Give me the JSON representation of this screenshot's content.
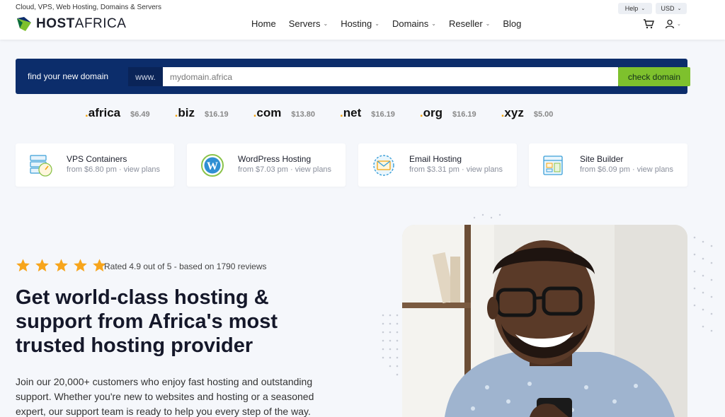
{
  "header": {
    "tagline": "Cloud, VPS, Web Hosting, Domains & Servers",
    "logo": {
      "bold": "HOST",
      "rest": "AFRICA"
    },
    "nav": [
      {
        "label": "Home",
        "dropdown": false
      },
      {
        "label": "Servers",
        "dropdown": true
      },
      {
        "label": "Hosting",
        "dropdown": true
      },
      {
        "label": "Domains",
        "dropdown": true
      },
      {
        "label": "Reseller",
        "dropdown": true
      },
      {
        "label": "Blog",
        "dropdown": false
      }
    ],
    "help": "Help",
    "currency": "USD",
    "icons": {
      "cart": "cart-icon",
      "user": "user-icon"
    }
  },
  "domain_search": {
    "label": "find your new domain",
    "prefix": "www.",
    "placeholder": "mydomain.africa",
    "button": "check domain"
  },
  "tlds": [
    {
      "name": "africa",
      "price": "$6.49"
    },
    {
      "name": "biz",
      "price": "$16.19"
    },
    {
      "name": "com",
      "price": "$13.80"
    },
    {
      "name": "net",
      "price": "$16.19"
    },
    {
      "name": "org",
      "price": "$16.19"
    },
    {
      "name": "xyz",
      "price": "$5.00"
    }
  ],
  "products": [
    {
      "title": "VPS Containers",
      "sub": "from $6.80 pm · view plans",
      "icon": "vps-icon"
    },
    {
      "title": "WordPress Hosting",
      "sub": "from $7.03 pm · view plans",
      "icon": "wordpress-icon"
    },
    {
      "title": "Email Hosting",
      "sub": "from $3.31 pm · view plans",
      "icon": "email-icon"
    },
    {
      "title": "Site Builder",
      "sub": "from $6.09 pm · view plans",
      "icon": "site-builder-icon"
    }
  ],
  "hero": {
    "stars": 5,
    "rating": "Rated 4.9 out of 5 - based on 1790 reviews",
    "headline": "Get world-class hosting & support from Africa's most trusted hosting provider",
    "body": "Join our 20,000+ customers who enjoy fast hosting and outstanding support. Whether you're new to websites and hosting or a seasoned expert, our support team is ready to help you every step of the way."
  },
  "colors": {
    "brand_navy": "#0c2d6b",
    "accent_green": "#7ec12d",
    "dot_orange": "#f3a40d",
    "star": "#f7a51c"
  }
}
